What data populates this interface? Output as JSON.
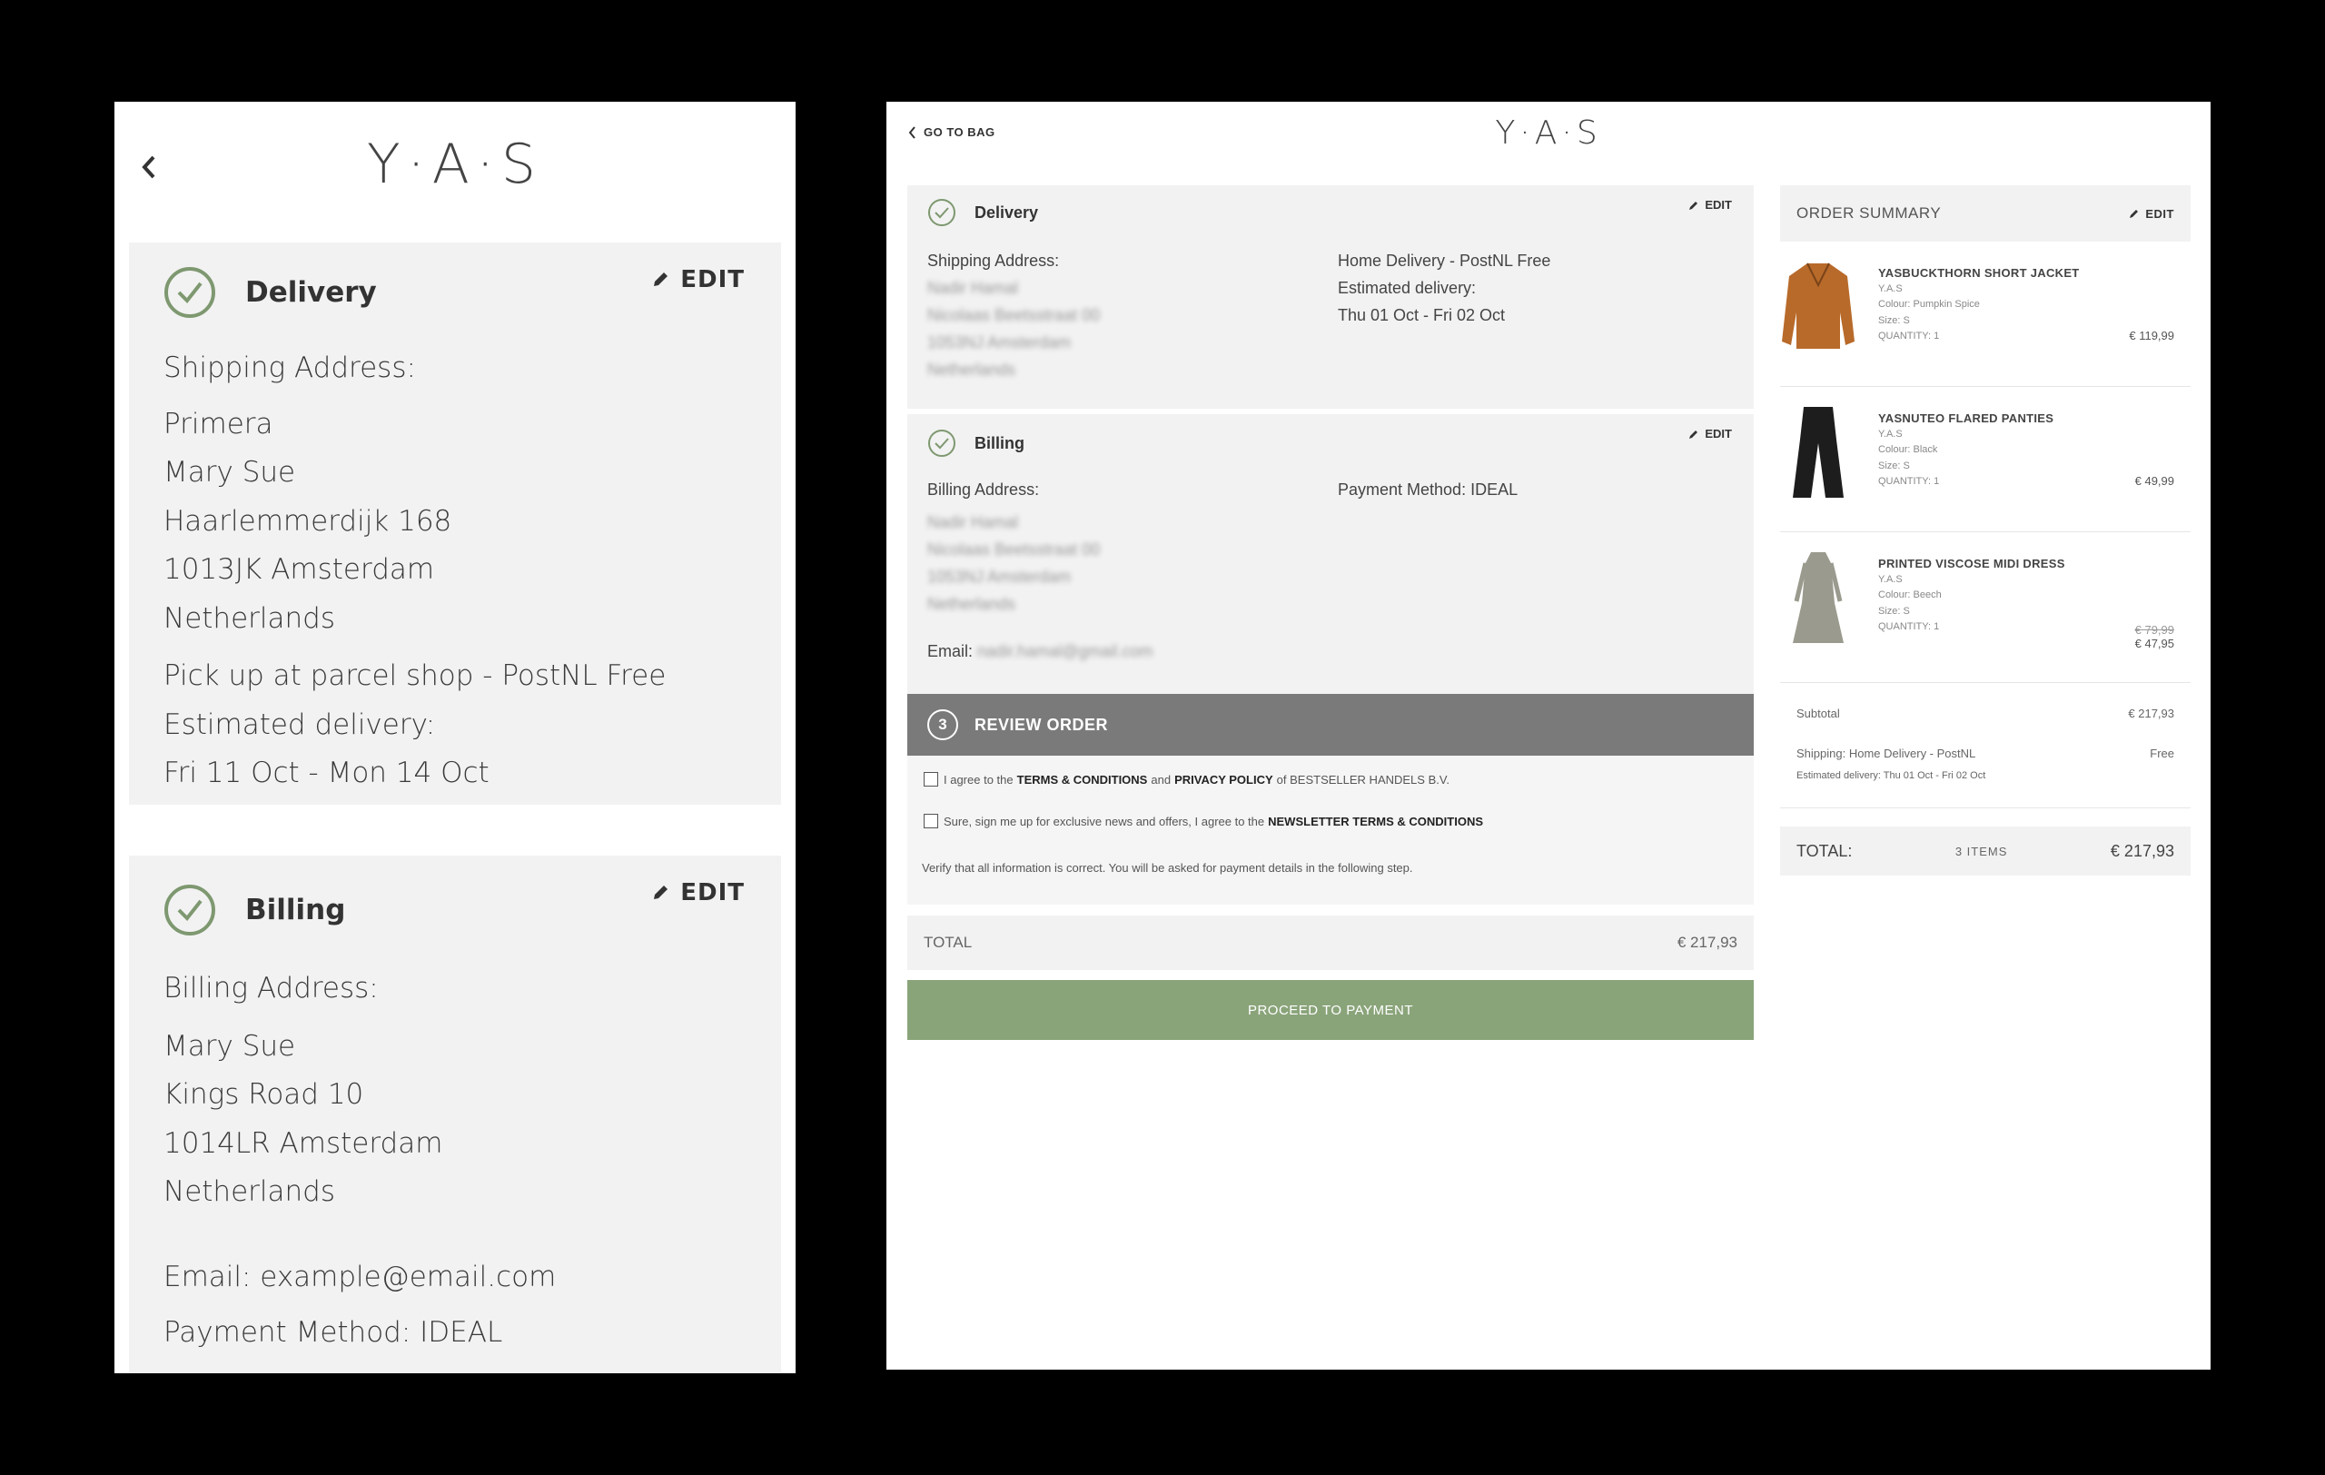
{
  "mobile": {
    "logo": "Y·A·S",
    "delivery": {
      "title": "Delivery",
      "edit_label": "EDIT",
      "shipping_label": "Shipping Address:",
      "address": [
        "Primera",
        "Mary Sue",
        "Haarlemmerdijk 168",
        "1013JK Amsterdam",
        "Netherlands"
      ],
      "method": "Pick up at parcel shop - PostNL Free",
      "estimated_label": "Estimated delivery:",
      "estimated_dates": "Fri 11 Oct - Mon 14 Oct"
    },
    "billing": {
      "title": "Billing",
      "edit_label": "EDIT",
      "billing_label": "Billing Address:",
      "address": [
        "Mary Sue",
        "Kings Road 10",
        "1014LR Amsterdam",
        "Netherlands"
      ],
      "email": "Email: example@email.com",
      "payment": "Payment Method: IDEAL"
    }
  },
  "desktop": {
    "back_label": "GO TO BAG",
    "logo": "Y·A·S",
    "delivery": {
      "title": "Delivery",
      "edit_label": "EDIT",
      "shipping_label": "Shipping Address:",
      "address_blurred": [
        "Nadir Hamal",
        "Nicolaas Beetsstraat 00",
        "1053NJ Amsterdam",
        "Netherlands"
      ],
      "method": "Home Delivery - PostNL Free",
      "estimated_label": "Estimated delivery:",
      "estimated_dates": "Thu 01 Oct - Fri 02 Oct"
    },
    "billing": {
      "title": "Billing",
      "edit_label": "EDIT",
      "billing_label": "Billing Address:",
      "address_blurred": [
        "Nadir Hamal",
        "Nicolaas Beetsstraat 00",
        "1053NJ Amsterdam",
        "Netherlands"
      ],
      "payment": "Payment Method: IDEAL",
      "email_label": "Email:",
      "email_blurred": "nadir.hamal@gmail.com"
    },
    "review": {
      "number": "3",
      "title": "REVIEW ORDER",
      "terms_pre": "I agree to the",
      "terms_link": "TERMS & CONDITIONS",
      "terms_and": "and",
      "privacy_link": "PRIVACY POLICY",
      "terms_post": "of BESTSELLER HANDELS B.V.",
      "newsletter_pre": "Sure, sign me up for exclusive news and offers, I agree to the",
      "newsletter_link": "NEWSLETTER TERMS & CONDITIONS",
      "verify_note": "Verify that all information is correct. You will be asked for payment details in the following step."
    },
    "total_label": "TOTAL",
    "total_value": "€ 217,93",
    "proceed_label": "PROCEED TO PAYMENT",
    "summary": {
      "title": "ORDER SUMMARY",
      "edit_label": "EDIT",
      "items": [
        {
          "name": "YASBUCKTHORN SHORT JACKET",
          "brand": "Y.A.S",
          "colour": "Colour: Pumpkin Spice",
          "size": "Size: S",
          "quantity": "QUANTITY: 1",
          "price": "€ 119,99",
          "color": "#b86a2a"
        },
        {
          "name": "YASNUTEO FLARED PANTIES",
          "brand": "Y.A.S",
          "colour": "Colour: Black",
          "size": "Size: S",
          "quantity": "QUANTITY: 1",
          "price": "€ 49,99",
          "color": "#1d1d1d"
        },
        {
          "name": "PRINTED VISCOSE MIDI DRESS",
          "brand": "Y.A.S",
          "colour": "Colour: Beech",
          "size": "Size: S",
          "quantity": "QUANTITY: 1",
          "old_price": "€ 79,99",
          "price": "€ 47,95",
          "color": "#9a9a8e"
        }
      ],
      "subtotal_label": "Subtotal",
      "subtotal_value": "€ 217,93",
      "shipping_label": "Shipping: Home Delivery - PostNL",
      "shipping_value": "Free",
      "estimated": "Estimated delivery: Thu 01 Oct - Fri 02 Oct",
      "total_label": "TOTAL:",
      "items_count": "3 ITEMS",
      "total_value": "€ 217,93"
    }
  }
}
